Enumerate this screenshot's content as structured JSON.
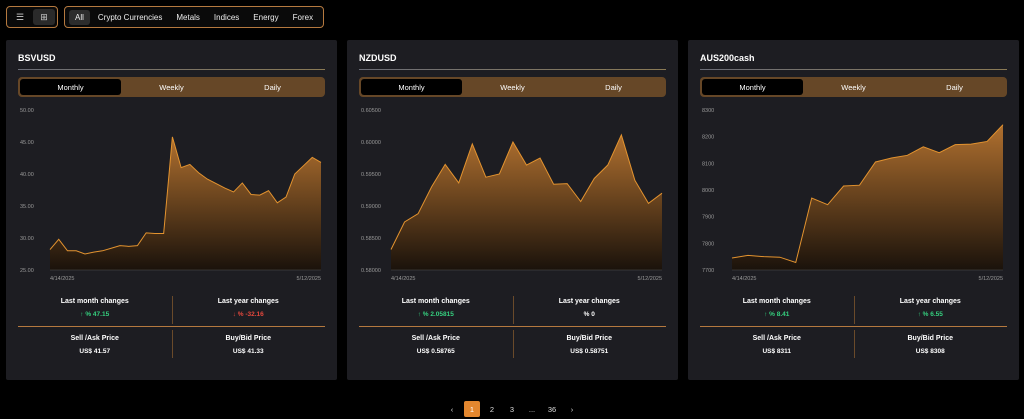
{
  "view_toggle": {
    "list_icon": "list-icon",
    "grid_icon": "grid-icon"
  },
  "filters": [
    "All",
    "Crypto Currencies",
    "Metals",
    "Indices",
    "Energy",
    "Forex"
  ],
  "periods": [
    "Monthly",
    "Weekly",
    "Daily"
  ],
  "labels": {
    "last_month": "Last month changes",
    "last_year": "Last year changes",
    "sell": "Sell /Ask Price",
    "buy": "Buy/Bid Price"
  },
  "colors": {
    "accent": "#e3872f",
    "positive": "#35d07f",
    "negative": "#e5483d"
  },
  "cards": [
    {
      "symbol": "BSVUSD",
      "last_month": "↑ % 47.15",
      "last_month_dir": "up",
      "last_year": "↓ % -32.16",
      "last_year_dir": "down",
      "sell": "US$  41.57",
      "buy": "US$  41.33"
    },
    {
      "symbol": "NZDUSD",
      "last_month": "↑ % 2.05815",
      "last_month_dir": "up",
      "last_year": "% 0",
      "last_year_dir": "flat",
      "sell": "US$  0.58765",
      "buy": "US$  0.58751"
    },
    {
      "symbol": "AUS200cash",
      "last_month": "↑ % 8.41",
      "last_month_dir": "up",
      "last_year": "↑ % 6.55",
      "last_year_dir": "up",
      "sell": "US$  8311",
      "buy": "US$  8308"
    }
  ],
  "chart_data": [
    {
      "type": "area",
      "x_start": "4/14/2025",
      "x_end": "5/12/2025",
      "y_ticks": [
        "50.00",
        "45.00",
        "40.00",
        "35.00",
        "30.00",
        "25.00"
      ],
      "ylim": [
        25,
        50
      ],
      "values": [
        28.2,
        29.8,
        28.0,
        28.0,
        27.5,
        27.8,
        28.0,
        28.4,
        28.8,
        28.7,
        28.8,
        30.8,
        30.7,
        30.7,
        45.8,
        41.0,
        41.5,
        40.2,
        39.2,
        38.5,
        37.8,
        37.2,
        38.6,
        36.8,
        36.7,
        37.4,
        35.5,
        36.4,
        40.0,
        41.3,
        42.6,
        41.8
      ]
    },
    {
      "type": "area",
      "x_start": "4/14/2025",
      "x_end": "5/12/2025",
      "y_ticks": [
        "0.60500",
        "0.60000",
        "0.59500",
        "0.59000",
        "0.58500",
        "0.58000"
      ],
      "ylim": [
        0.58,
        0.605
      ],
      "values": [
        0.5832,
        0.5875,
        0.5888,
        0.593,
        0.5965,
        0.5936,
        0.5997,
        0.5945,
        0.595,
        0.6,
        0.5964,
        0.5975,
        0.5934,
        0.5935,
        0.5907,
        0.5943,
        0.5964,
        0.6011,
        0.594,
        0.5904,
        0.592
      ]
    },
    {
      "type": "area",
      "x_start": "4/14/2025",
      "x_end": "5/12/2025",
      "y_ticks": [
        "8300",
        "8200",
        "8100",
        "8000",
        "7900",
        "7800",
        "7700"
      ],
      "ylim": [
        7700,
        8300
      ],
      "values": [
        7745,
        7755,
        7750,
        7748,
        7728,
        7970,
        7945,
        8015,
        8018,
        8105,
        8120,
        8130,
        8162,
        8140,
        8170,
        8172,
        8182,
        8245
      ]
    }
  ],
  "pagination": {
    "prev": "‹",
    "pages": [
      "1",
      "2",
      "3",
      "...",
      "36"
    ],
    "next": "›",
    "current": "1"
  }
}
